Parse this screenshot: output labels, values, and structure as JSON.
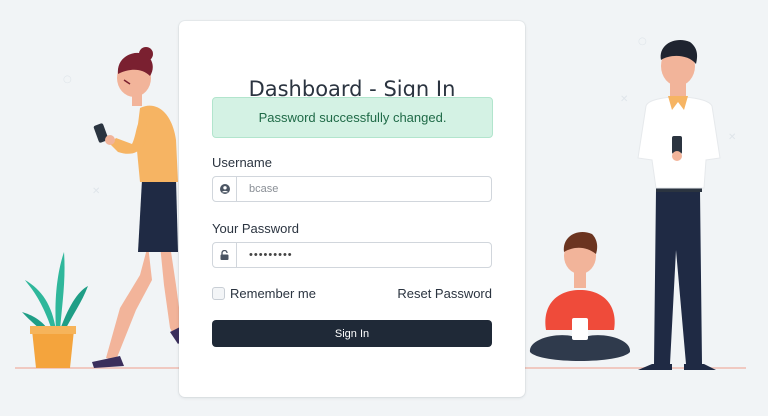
{
  "form": {
    "title": "Dashboard - Sign In",
    "alert": "Password successfully changed.",
    "username_label": "Username",
    "username_placeholder": "bcase",
    "password_label": "Your Password",
    "password_value": "•••••••••",
    "remember_label": "Remember me",
    "reset_label": "Reset Password",
    "signin_label": "Sign In"
  },
  "icons": {
    "user": "user-circle-icon",
    "lock": "lock-icon"
  },
  "colors": {
    "background": "#f1f4f6",
    "alert_bg": "#d4f2e4",
    "alert_text": "#1f6a47",
    "button_bg": "#1f2937",
    "accent_orange": "#f4b35a",
    "accent_red": "#ef4b3a"
  }
}
